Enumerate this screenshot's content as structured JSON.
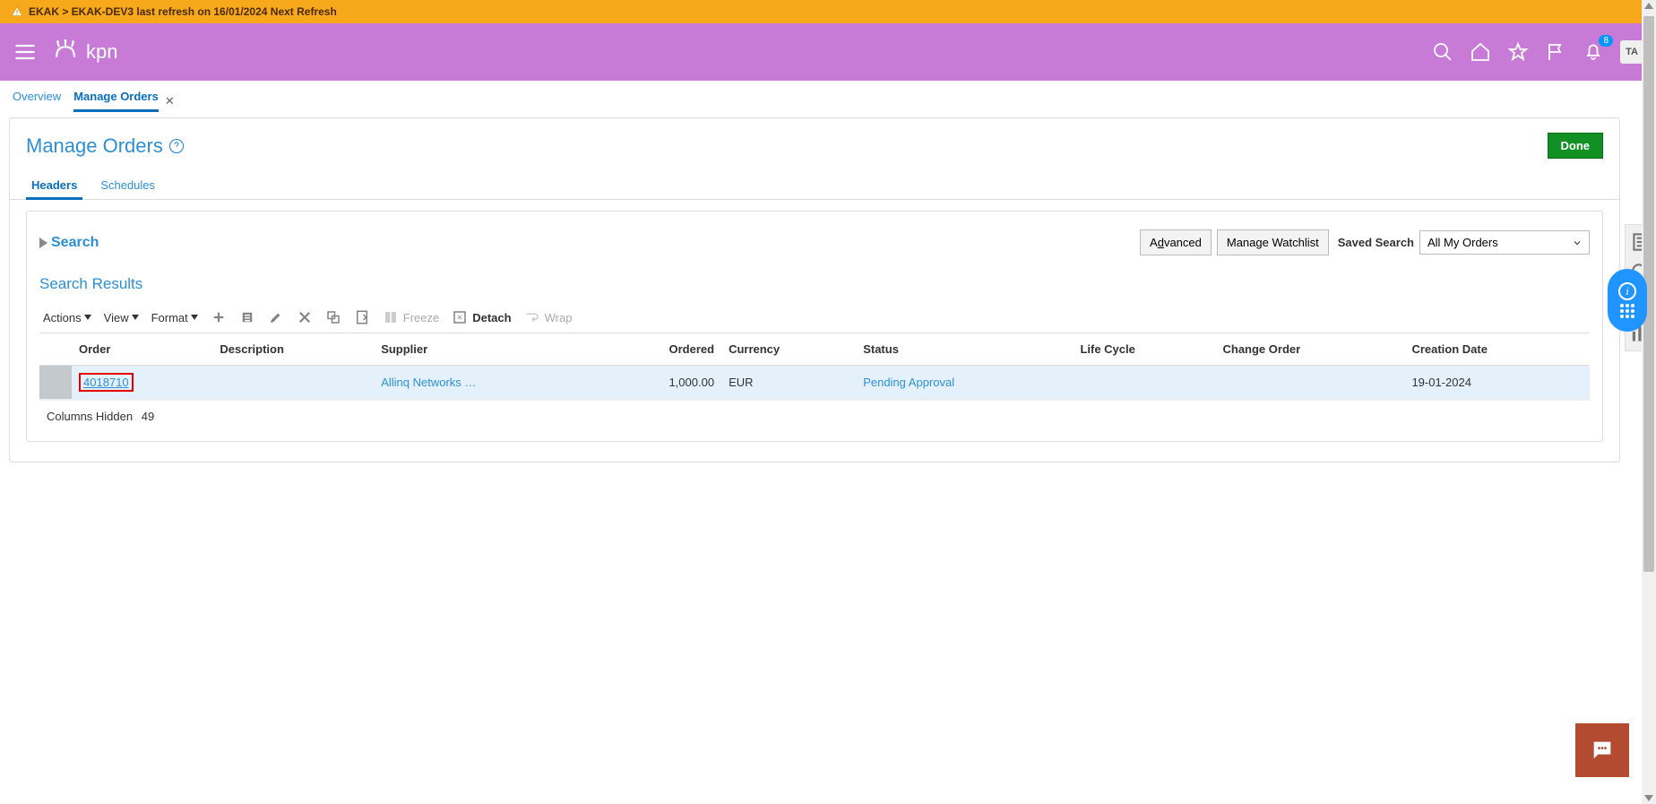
{
  "warning_bar": {
    "text": "EKAK > EKAK-DEV3 last refresh on 16/01/2024 Next Refresh"
  },
  "top_nav": {
    "logo_text": "kpn",
    "notifications_count": "8",
    "avatar_initials": "TA"
  },
  "breadcrumb": {
    "overview": "Overview",
    "manage_orders": "Manage Orders"
  },
  "page": {
    "title": "Manage Orders",
    "done_btn": "Done"
  },
  "sub_tabs": {
    "headers": "Headers",
    "schedules": "Schedules"
  },
  "search": {
    "toggle_label": "Search",
    "advanced_btn_pre": "A",
    "advanced_btn_char": "d",
    "advanced_btn_post": "vanced",
    "manage_watchlist_btn": "Manage Watchlist",
    "saved_search_label": "Saved Search",
    "saved_search_value": "All My Orders"
  },
  "search_results": {
    "title": "Search Results"
  },
  "toolbar": {
    "actions": "Actions",
    "view": "View",
    "format": "Format",
    "freeze": "Freeze",
    "detach": "Detach",
    "wrap": "Wrap"
  },
  "table": {
    "headers": {
      "order": "Order",
      "description": "Description",
      "supplier": "Supplier",
      "ordered": "Ordered",
      "currency": "Currency",
      "status": "Status",
      "life_cycle": "Life Cycle",
      "change_order": "Change Order",
      "creation_date": "Creation Date"
    },
    "rows": [
      {
        "order": "4018710",
        "description": "",
        "supplier": "Allinq Networks …",
        "ordered": "1,000.00",
        "currency": "EUR",
        "status": "Pending Approval",
        "life_cycle": "",
        "change_order": "",
        "creation_date": "19-01-2024"
      }
    ],
    "columns_hidden_label": "Columns Hidden",
    "columns_hidden_count": "49"
  }
}
